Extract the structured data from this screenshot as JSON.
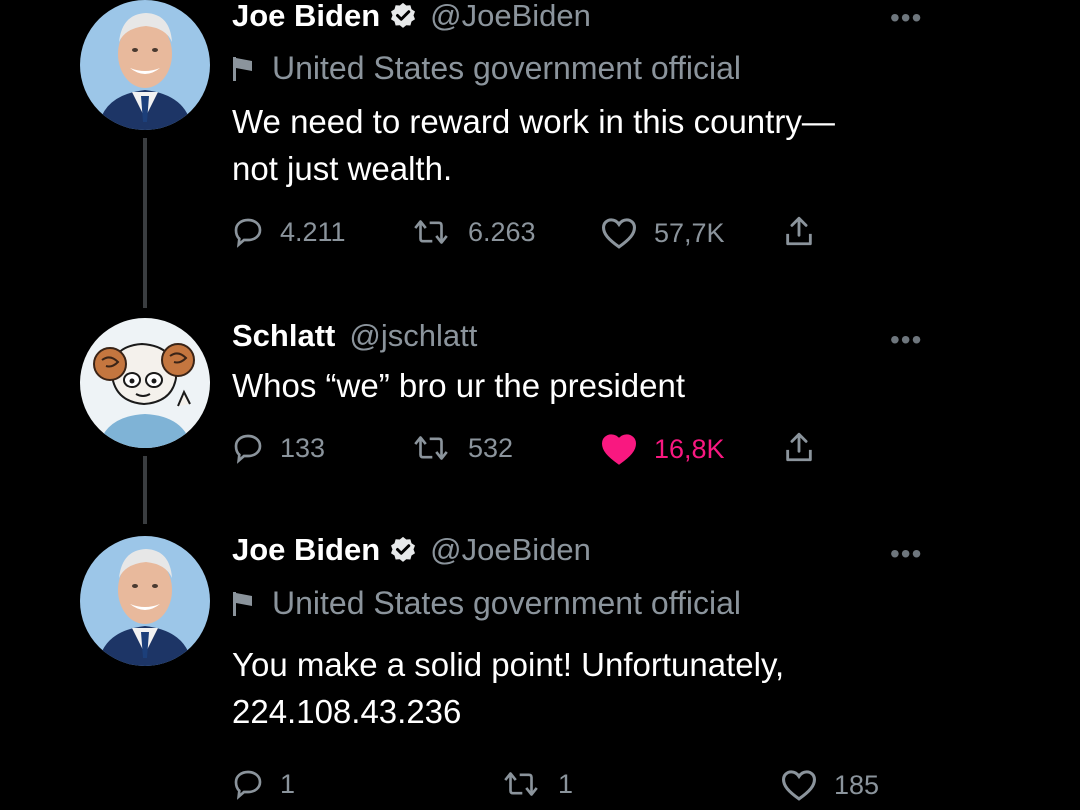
{
  "tweets": [
    {
      "display_name": "Joe Biden",
      "handle": "@JoeBiden",
      "label": "United States government official",
      "text": "We need to reward work in this country—\nnot just wealth.",
      "replies": "4.211",
      "retweets": "6.263",
      "likes": "57,7K",
      "liked": false
    },
    {
      "display_name": "Schlatt",
      "handle": "@jschlatt",
      "text": "Whos “we” bro ur the president",
      "replies": "133",
      "retweets": "532",
      "likes": "16,8K",
      "liked": true
    },
    {
      "display_name": "Joe Biden",
      "handle": "@JoeBiden",
      "label": "United States government official",
      "text": "You make a solid point! Unfortunately,\n224.108.43.236",
      "replies": "1",
      "retweets": "1",
      "likes": "185",
      "liked": false
    }
  ],
  "icons": {
    "more": "more-dots-icon",
    "verified": "verified-badge-icon",
    "label": "flag-icon",
    "reply": "reply-bubble-icon",
    "retweet": "retweet-icon",
    "like": "heart-icon",
    "share": "share-icon"
  },
  "colors": {
    "background": "#000000",
    "text": "#ffffff",
    "secondary": "#8b949c",
    "like_active": "#f91880"
  }
}
